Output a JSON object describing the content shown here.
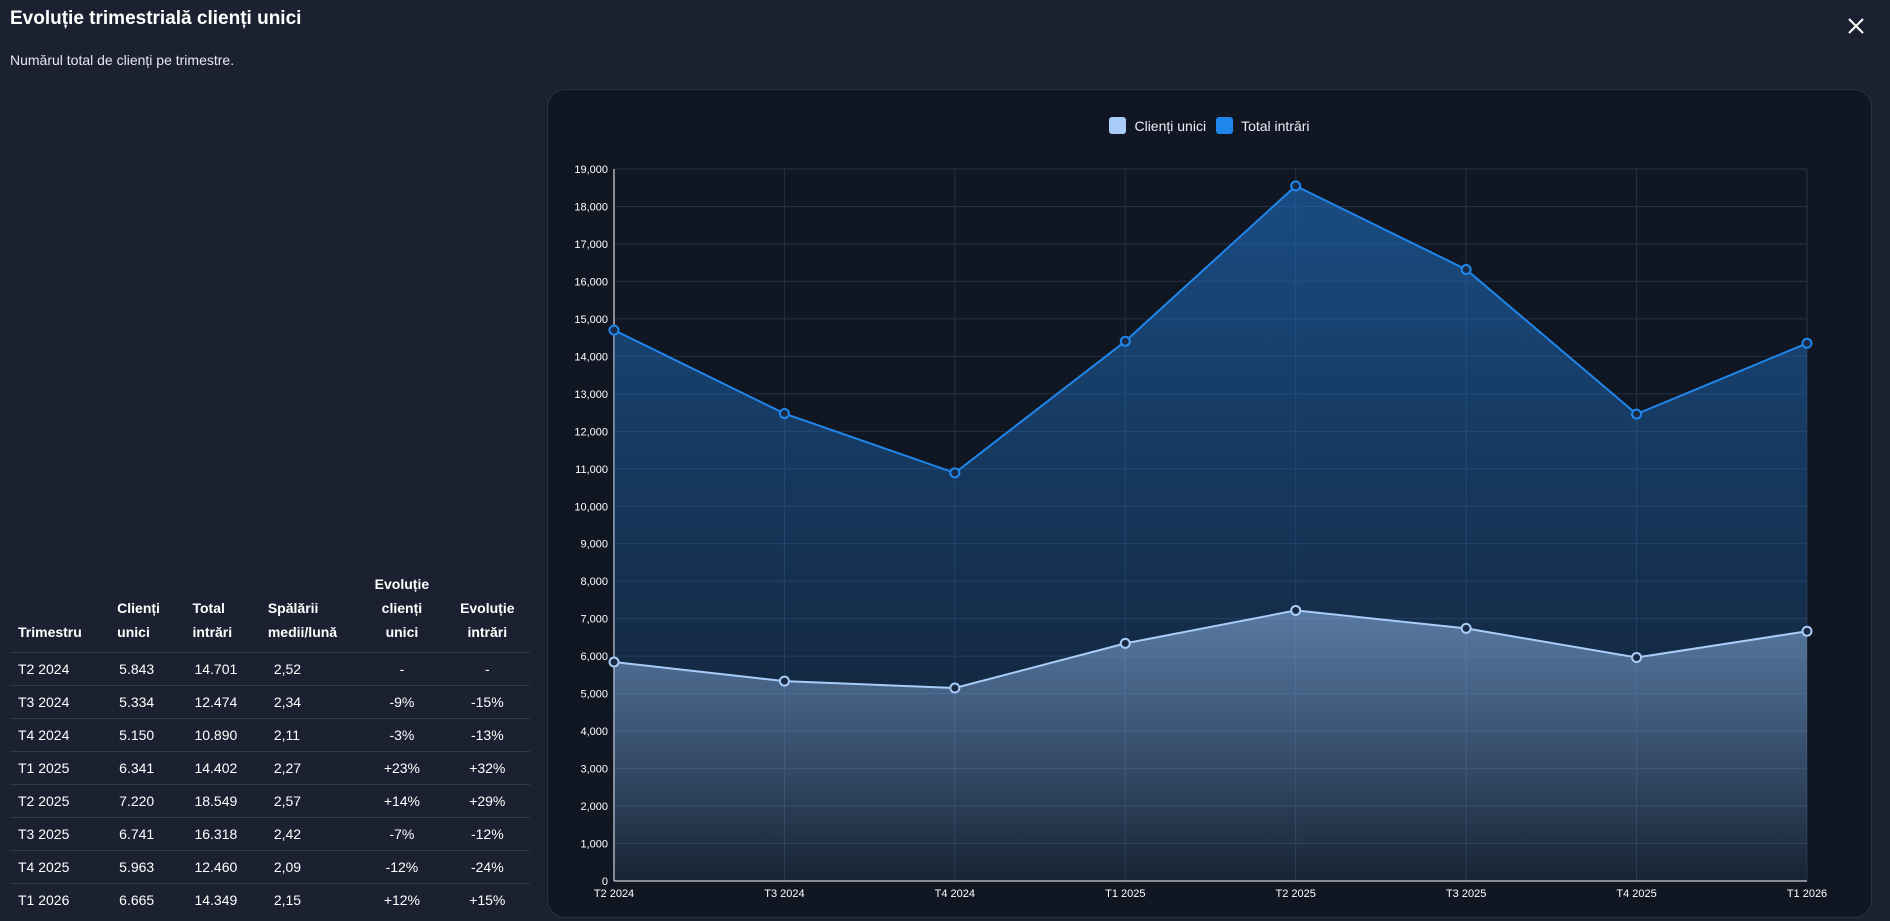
{
  "header": {
    "title": "Evoluție trimestrială clienți unici",
    "subtitle": "Numărul total de clienți pe trimestre."
  },
  "table": {
    "columns": [
      [
        "Trimestru"
      ],
      [
        "Clienți",
        "unici"
      ],
      [
        "Total",
        "intrări"
      ],
      [
        "Spălării",
        "medii/lună"
      ],
      [
        "Evoluție",
        "clienți",
        "unici"
      ],
      [
        "Evoluție",
        "intrări"
      ]
    ],
    "rows": [
      [
        "T2 2024",
        "5.843",
        "14.701",
        "2,52",
        "-",
        "-"
      ],
      [
        "T3 2024",
        "5.334",
        "12.474",
        "2,34",
        "-9%",
        "-15%"
      ],
      [
        "T4 2024",
        "5.150",
        "10.890",
        "2,11",
        "-3%",
        "-13%"
      ],
      [
        "T1 2025",
        "6.341",
        "14.402",
        "2,27",
        "+23%",
        "+32%"
      ],
      [
        "T2 2025",
        "7.220",
        "18.549",
        "2,57",
        "+14%",
        "+29%"
      ],
      [
        "T3 2025",
        "6.741",
        "16.318",
        "2,42",
        "-7%",
        "-12%"
      ],
      [
        "T4 2025",
        "5.963",
        "12.460",
        "2,09",
        "-12%",
        "-24%"
      ],
      [
        "T1 2026",
        "6.665",
        "14.349",
        "2,15",
        "+12%",
        "+15%"
      ]
    ]
  },
  "chart_data": {
    "type": "area",
    "categories": [
      "T2 2024",
      "T3 2024",
      "T4 2024",
      "T1 2025",
      "T2 2025",
      "T3 2025",
      "T4 2025",
      "T1 2026"
    ],
    "series": [
      {
        "name": "Clienți unici",
        "values": [
          5843,
          5334,
          5150,
          6341,
          7220,
          6741,
          5963,
          6665
        ],
        "color": "#a9cdf8"
      },
      {
        "name": "Total intrări",
        "values": [
          14701,
          12474,
          10890,
          14402,
          18549,
          16318,
          12460,
          14349
        ],
        "color": "#1f86ec"
      }
    ],
    "ylim": [
      0,
      19000
    ],
    "yticks": [
      "0",
      "1,000",
      "2,000",
      "3,000",
      "4,000",
      "5,000",
      "6,000",
      "7,000",
      "8,000",
      "9,000",
      "10,000",
      "11,000",
      "12,000",
      "13,000",
      "14,000",
      "15,000",
      "16,000",
      "17,000",
      "18,000",
      "19,000"
    ],
    "legend": "top-center",
    "grid": true
  },
  "colors": {
    "background": "#1b2130",
    "panel": "#111722",
    "series1": "#a9cdf8",
    "series2": "#1f86ec"
  }
}
